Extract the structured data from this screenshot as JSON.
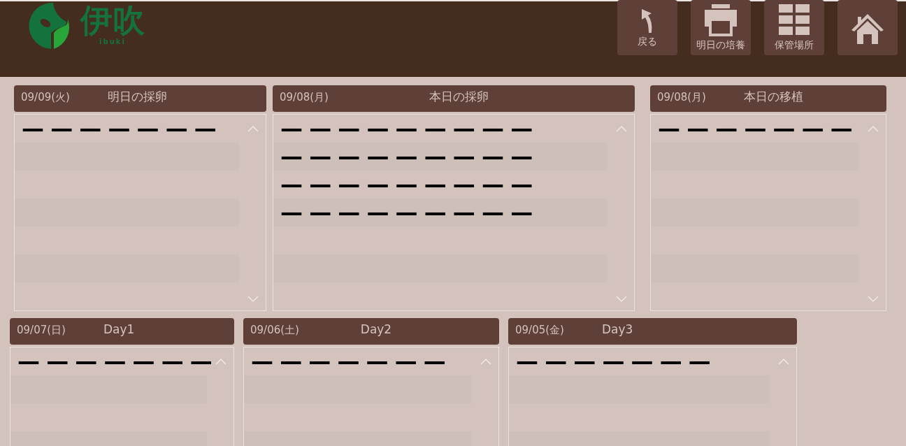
{
  "header": {
    "logo": {
      "text": "伊吹",
      "subtext": "ibuki"
    },
    "buttons": [
      {
        "kind": "back",
        "label": "戻る"
      },
      {
        "kind": "print",
        "label": "明日の培養"
      },
      {
        "kind": "grid",
        "label": "保管場所"
      },
      {
        "kind": "home"
      }
    ]
  },
  "panels": [
    {
      "date": "09/09(火)",
      "title": "明日の採卵",
      "lines": [
        "— — — — — — —"
      ]
    },
    {
      "date": "09/08(月)",
      "title": "本日の採卵",
      "lines": [
        "— — — — — — — — —",
        "— — — — — — — — —",
        "— — — — — — — — —",
        "— — — — — — — — —"
      ]
    },
    {
      "date": "09/08(月)",
      "title": "本日の移植",
      "lines": [
        "— — — — — — —"
      ]
    },
    {
      "date": "09/07(日)",
      "title": "Day1",
      "lines": [
        "— — — — — — —"
      ]
    },
    {
      "date": "09/06(土)",
      "title": "Day2",
      "lines": [
        "— — — — — — —"
      ]
    },
    {
      "date": "09/05(金)",
      "title": "Day3",
      "lines": [
        "— — — — — — —"
      ]
    }
  ]
}
